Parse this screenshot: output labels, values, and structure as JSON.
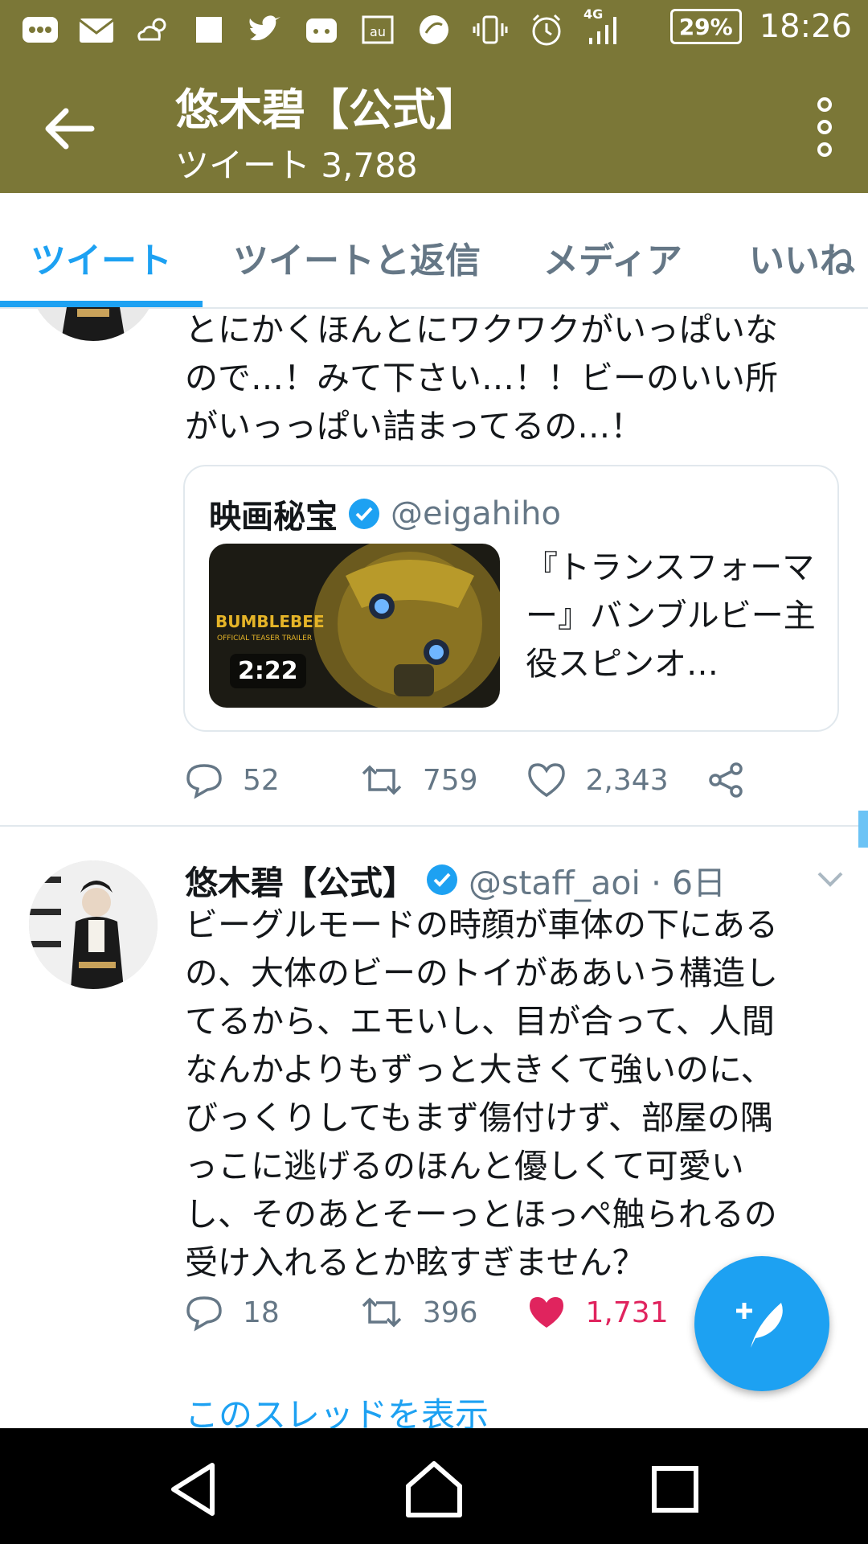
{
  "status_bar": {
    "battery": "29%",
    "network": "4G",
    "time": "18:26"
  },
  "header": {
    "title": "悠木碧【公式】",
    "subtitle": "ツイート 3,788"
  },
  "tabs": [
    {
      "label": "ツイート",
      "active": true
    },
    {
      "label": "ツイートと返信",
      "active": false
    },
    {
      "label": "メディア",
      "active": false
    },
    {
      "label": "いいね",
      "active": false
    }
  ],
  "tweet1": {
    "text": "とにかくほんとにワクワクがいっぱいな\nので…！みて下さい…！！ビーのいい所\nがいっっぱい詰まってるの…！",
    "card": {
      "author_name": "映画秘宝",
      "author_handle": "@eigahiho",
      "thumb_brand": "BUMBLEBEE",
      "thumb_caption": "OFFICIAL TEASER TRAILER",
      "duration": "2:22",
      "title": "『トランスフォーマー』バンブルビー主役スピンオ…"
    },
    "replies": "52",
    "retweets": "759",
    "likes": "2,343"
  },
  "tweet2": {
    "author_name": "悠木碧【公式】",
    "handle_time": "@staff_aoi · 6日",
    "text": "ビーグルモードの時顔が車体の下にある\nの、大体のビーのトイがああいう構造し\nてるから、エモいし、目が合って、人間\nなんかよりもずっと大きくて強いのに、\nびっくりしてもまず傷付けず、部屋の隅\nっこに逃げるのほんと優しくて可愛い\nし、そのあとそーっとほっぺ触られるの\n受け入れるとか眩すぎません？",
    "replies": "18",
    "retweets": "396",
    "likes": "1,731",
    "thread_link": "このスレッドを表示"
  },
  "colors": {
    "header_bg": "#7b7737",
    "accent": "#1da1f2",
    "like": "#e0245e",
    "secondary_text": "#657786"
  }
}
